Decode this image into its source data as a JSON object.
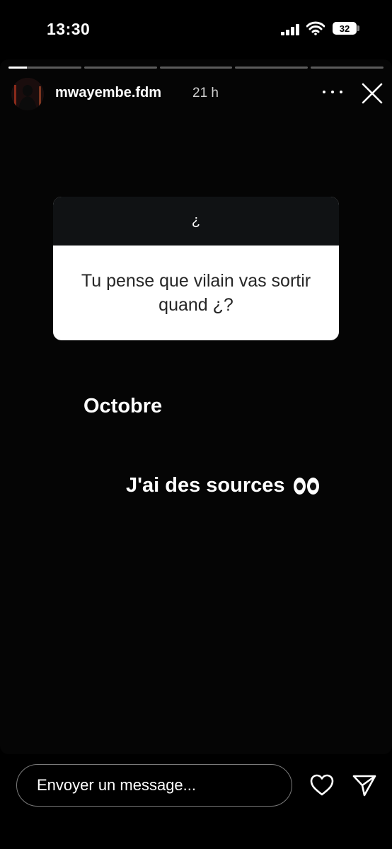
{
  "status_bar": {
    "time": "13:30",
    "battery": "32"
  },
  "story": {
    "progress_segments": 5,
    "progress_current_fraction": 0.25,
    "username": "mwayembe.fdm",
    "time_ago": "21 h",
    "question_card": {
      "header": "¿",
      "question": "Tu pense que vilain vas sortir quand ¿?"
    },
    "answer_line_1": "Octobre",
    "answer_line_2": "J'ai des sources"
  },
  "bottom_bar": {
    "message_placeholder": "Envoyer un message..."
  },
  "icons": [
    "signal-icon",
    "wifi-icon",
    "battery-icon",
    "more-icon",
    "close-icon",
    "eyes-emoji",
    "heart-icon",
    "send-icon"
  ]
}
